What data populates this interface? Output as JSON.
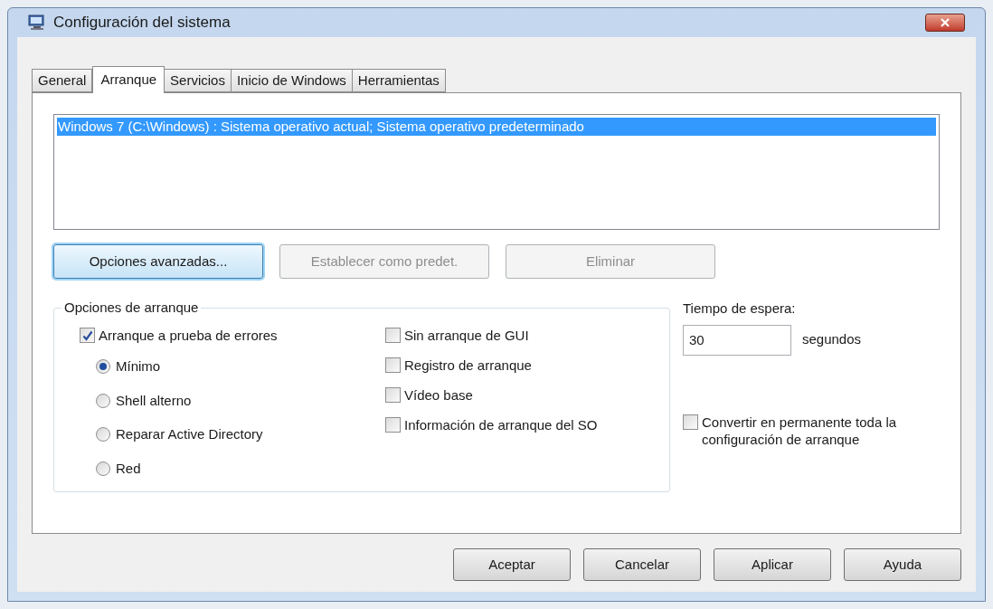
{
  "window": {
    "title": "Configuración del sistema"
  },
  "tabs": [
    {
      "label": "General",
      "selected": false
    },
    {
      "label": "Arranque",
      "selected": true
    },
    {
      "label": "Servicios",
      "selected": false
    },
    {
      "label": "Inicio de Windows",
      "selected": false
    },
    {
      "label": "Herramientas",
      "selected": false
    }
  ],
  "os_list": [
    {
      "label": "Windows 7 (C:\\Windows) : Sistema operativo actual; Sistema operativo predeterminado",
      "selected": true
    }
  ],
  "list_buttons": [
    {
      "label": "Opciones avanzadas...",
      "disabled": false,
      "focused": true
    },
    {
      "label": "Establecer como predet.",
      "disabled": true,
      "focused": false
    },
    {
      "label": "Eliminar",
      "disabled": true,
      "focused": false
    }
  ],
  "boot_options": {
    "title": "Opciones de arranque",
    "safe_boot": {
      "label": "Arranque a prueba de errores",
      "checked": true
    },
    "modes": [
      {
        "label": "Mínimo",
        "selected": true
      },
      {
        "label": "Shell alterno",
        "selected": false
      },
      {
        "label": "Reparar Active Directory",
        "selected": false
      },
      {
        "label": "Red",
        "selected": false
      }
    ],
    "flags": [
      {
        "label": "Sin arranque de GUI",
        "checked": false
      },
      {
        "label": "Registro de arranque",
        "checked": false
      },
      {
        "label": "Vídeo base",
        "checked": false
      },
      {
        "label": "Información de arranque del SO",
        "checked": false
      }
    ]
  },
  "timeout": {
    "label": "Tiempo de espera:",
    "value": "30",
    "unit": "segundos"
  },
  "permanent": {
    "label": "Convertir en permanente toda la configuración de arranque",
    "checked": false
  },
  "footer_buttons": [
    "Aceptar",
    "Cancelar",
    "Aplicar",
    "Ayuda"
  ]
}
